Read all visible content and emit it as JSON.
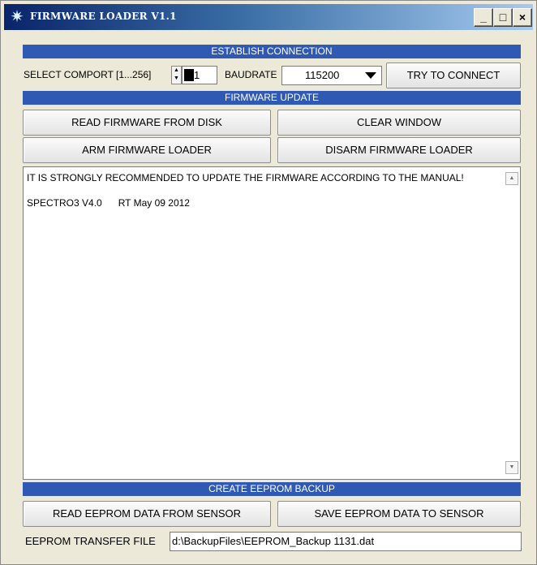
{
  "window": {
    "title": "FIRMWARE LOADER V1.1",
    "controls": {
      "minimize": "_",
      "maximize": "□",
      "close": "×"
    }
  },
  "sections": {
    "establish": "ESTABLISH CONNECTION",
    "firmware": "FIRMWARE UPDATE",
    "eeprom": "CREATE EEPROM BACKUP"
  },
  "connection": {
    "comport_label": "SELECT COMPORT [1...256]",
    "comport_value": "1",
    "baud_label": "BAUDRATE",
    "baud_value": "115200",
    "connect_button": "TRY TO CONNECT"
  },
  "firmware_buttons": {
    "read": "READ FIRMWARE FROM DISK",
    "clear": "CLEAR WINDOW",
    "arm": "ARM FIRMWARE LOADER",
    "disarm": "DISARM FIRMWARE LOADER"
  },
  "output": {
    "line1": "IT IS STRONGLY RECOMMENDED TO UPDATE THE FIRMWARE ACCORDING TO THE MANUAL!",
    "line2": "SPECTRO3 V4.0      RT May 09 2012"
  },
  "eeprom": {
    "read_button": "READ EEPROM DATA FROM SENSOR",
    "save_button": "SAVE EEPROM DATA TO SENSOR",
    "file_label": "EEPROM TRANSFER FILE",
    "file_value": "d:\\BackupFiles\\EEPROM_Backup 1131.dat"
  },
  "colors": {
    "section_bar": "#2f59b2",
    "title_gradient_start": "#0a246a",
    "title_gradient_end": "#a6caf0",
    "window_bg": "#ece9d8"
  },
  "icons": {
    "app": "firmware-loader-icon",
    "spinner": "up-down-spinner-icon",
    "select": "chevron-down-icon",
    "scroll_up": "scroll-up-icon",
    "scroll_down": "scroll-down-icon"
  }
}
